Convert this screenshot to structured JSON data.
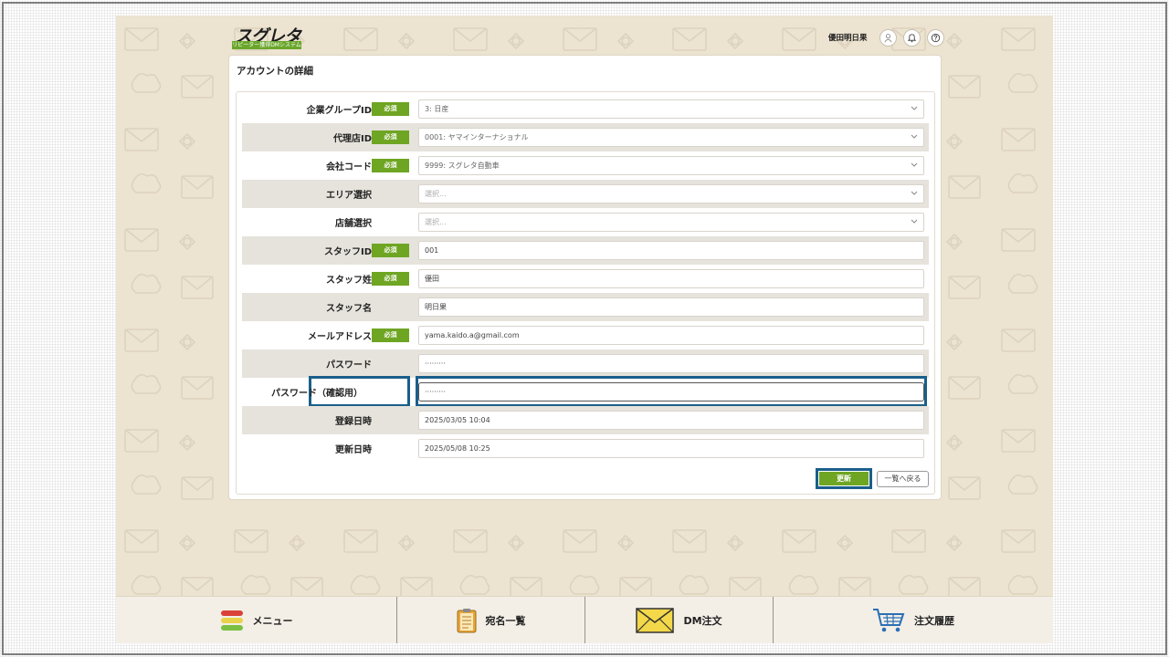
{
  "header": {
    "logo_text": "スグレタ",
    "logo_subtitle": "リピーター獲得DMシステム",
    "user_name": "優田明日果"
  },
  "card": {
    "title": "アカウントの詳細",
    "required_label": "必須",
    "rows": [
      {
        "label": "企業グループID",
        "value": "3: 日産",
        "required": true,
        "type": "select"
      },
      {
        "label": "代理店ID",
        "value": "0001: ヤマインターナショナル",
        "required": true,
        "type": "select"
      },
      {
        "label": "会社コード",
        "value": "9999: スグレタ自動車",
        "required": true,
        "type": "select"
      },
      {
        "label": "エリア選択",
        "value": "",
        "placeholder": "選択...",
        "required": false,
        "type": "select"
      },
      {
        "label": "店舗選択",
        "value": "",
        "placeholder": "選択...",
        "required": false,
        "type": "select"
      },
      {
        "label": "スタッフID",
        "value": "001",
        "required": true,
        "type": "input"
      },
      {
        "label": "スタッフ姓",
        "value": "優田",
        "required": true,
        "type": "input"
      },
      {
        "label": "スタッフ名",
        "value": "明日果",
        "required": false,
        "type": "input"
      },
      {
        "label": "メールアドレス",
        "value": "yama.kaido.a@gmail.com",
        "required": true,
        "type": "input"
      },
      {
        "label": "パスワード",
        "value": "·········",
        "required": false,
        "type": "input"
      },
      {
        "label": "パスワード（確認用）",
        "value": "·········",
        "required": false,
        "type": "input"
      },
      {
        "label": "登録日時",
        "value": "2025/03/05 10:04",
        "required": false,
        "type": "input"
      },
      {
        "label": "更新日時",
        "value": "2025/05/08 10:25",
        "required": false,
        "type": "input"
      }
    ],
    "update_button": "更新",
    "back_button": "一覧へ戻る"
  },
  "nav": {
    "menu": "メニュー",
    "address_list": "宛名一覧",
    "dm_order": "DM注文",
    "order_history": "注文履歴"
  },
  "colors": {
    "background": "#ece3d1",
    "accent_green": "#6ea523",
    "highlight_blue": "#1a5f8a"
  }
}
